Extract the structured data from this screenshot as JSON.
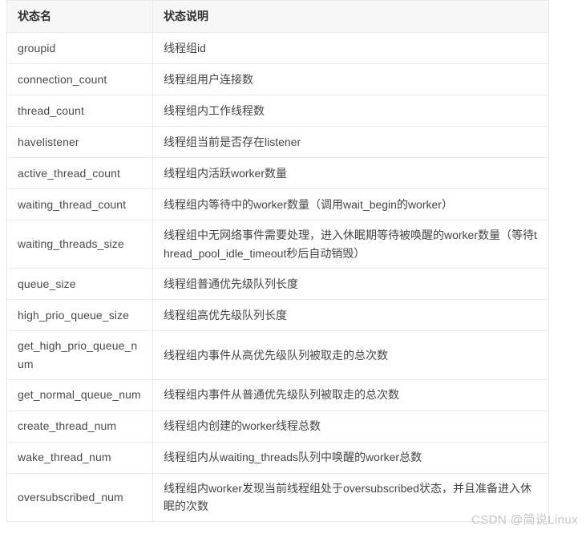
{
  "table": {
    "columns": [
      {
        "key": "name",
        "header": "状态名"
      },
      {
        "key": "desc",
        "header": "状态说明"
      }
    ],
    "rows": [
      {
        "name": "groupid",
        "desc": "线程组id"
      },
      {
        "name": "connection_count",
        "desc": "线程组用户连接数"
      },
      {
        "name": "thread_count",
        "desc": "线程组内工作线程数"
      },
      {
        "name": "havelistener",
        "desc": "线程组当前是否存在listener"
      },
      {
        "name": "active_thread_count",
        "desc": "线程组内活跃worker数量"
      },
      {
        "name": "waiting_thread_count",
        "desc": "线程组内等待中的worker数量（调用wait_begin的worker）"
      },
      {
        "name": "waiting_threads_size",
        "desc": "线程组中无网络事件需要处理，进入休眠期等待被唤醒的worker数量（等待thread_pool_idle_timeout秒后自动销毁）"
      },
      {
        "name": "queue_size",
        "desc": "线程组普通优先级队列长度"
      },
      {
        "name": "high_prio_queue_size",
        "desc": "线程组高优先级队列长度"
      },
      {
        "name": "get_high_prio_queue_num",
        "desc": "线程组内事件从高优先级队列被取走的总次数"
      },
      {
        "name": "get_normal_queue_num",
        "desc": "线程组内事件从普通优先级队列被取走的总次数"
      },
      {
        "name": "create_thread_num",
        "desc": "线程组内创建的worker线程总数"
      },
      {
        "name": "wake_thread_num",
        "desc": "线程组内从waiting_threads队列中唤醒的worker总数"
      },
      {
        "name": "oversubscribed_num",
        "desc": "线程组内worker发现当前线程组处于oversubscribed状态，并且准备进入休眠的次数"
      }
    ]
  },
  "watermark": {
    "text": "CSDN @简说Linux"
  },
  "colors": {
    "header_bg": "#f7f7f7",
    "border": "#e9e9e9",
    "text": "#4a4a4a",
    "watermark": "#c6c6c6"
  }
}
